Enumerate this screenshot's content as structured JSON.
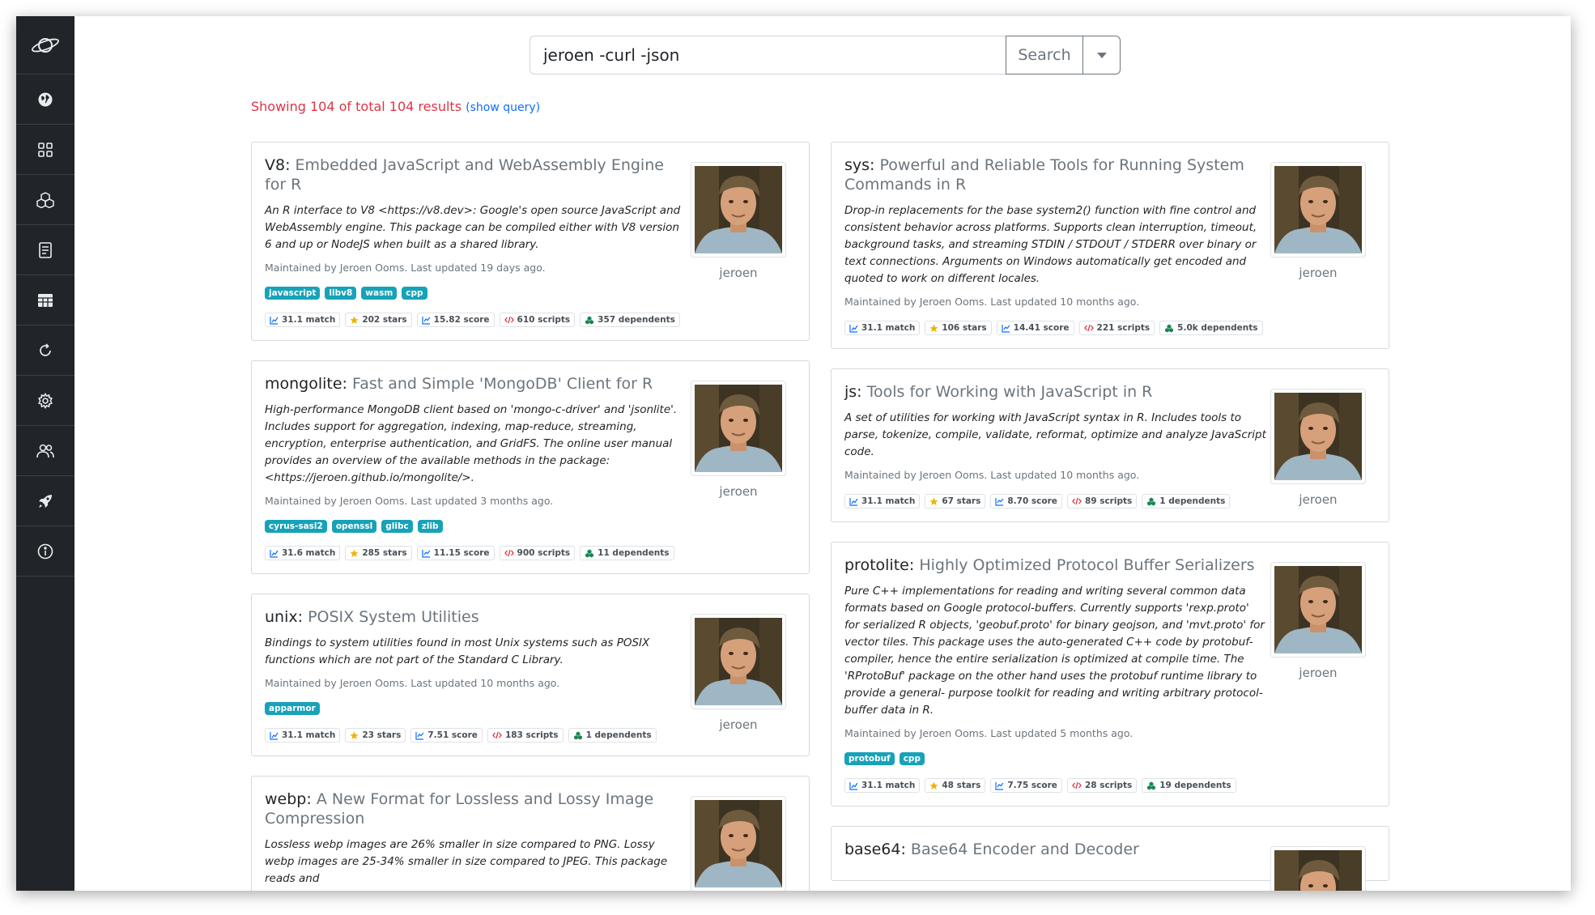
{
  "search": {
    "value": "jeroen -curl -json",
    "button_label": "Search"
  },
  "results": {
    "prefix": "Showing 104 of total 104 results",
    "show_query": "(show query)"
  },
  "sidebar": {
    "icons": [
      "planet-logo-icon",
      "globe-icon",
      "grid-icon",
      "packages-icon",
      "document-icon",
      "table-icon",
      "refresh-icon",
      "gear-icon",
      "users-icon",
      "rocket-icon",
      "info-icon"
    ]
  },
  "colors": {
    "sidebar": "#212529",
    "tag": "#17a2b8",
    "results_text": "#dc3545",
    "link": "#0d6efd"
  },
  "packages": [
    {
      "name": "V8:",
      "title": "Embedded JavaScript and WebAssembly Engine for R",
      "description": "An R interface to V8 <https://v8.dev>: Google's open source JavaScript and WebAssembly engine. This package can be compiled either with V8 version 6 and up or NodeJS when built as a shared library.",
      "maintainer": "Maintained by Jeroen Ooms. Last updated 19 days ago.",
      "tags": [
        "javascript",
        "libv8",
        "wasm",
        "cpp"
      ],
      "stats": [
        "31.1 match",
        "202 stars",
        "15.82 score",
        "610 scripts",
        "357 dependents"
      ],
      "user": "jeroen"
    },
    {
      "name": "mongolite:",
      "title": "Fast and Simple 'MongoDB' Client for R",
      "description": "High-performance MongoDB client based on 'mongo-c-driver' and 'jsonlite'. Includes support for aggregation, indexing, map-reduce, streaming, encryption, enterprise authentication, and GridFS. The online user manual provides an overview of the available methods in the package: <https://jeroen.github.io/mongolite/>.",
      "maintainer": "Maintained by Jeroen Ooms. Last updated 3 months ago.",
      "tags": [
        "cyrus-sasl2",
        "openssl",
        "glibc",
        "zlib"
      ],
      "stats": [
        "31.6 match",
        "285 stars",
        "11.15 score",
        "900 scripts",
        "11 dependents"
      ],
      "user": "jeroen"
    },
    {
      "name": "unix:",
      "title": "POSIX System Utilities",
      "description": "Bindings to system utilities found in most Unix systems such as POSIX functions which are not part of the Standard C Library.",
      "maintainer": "Maintained by Jeroen Ooms. Last updated 10 months ago.",
      "tags": [
        "apparmor"
      ],
      "stats": [
        "31.1 match",
        "23 stars",
        "7.51 score",
        "183 scripts",
        "1 dependents"
      ],
      "user": "jeroen"
    },
    {
      "name": "webp:",
      "title": "A New Format for Lossless and Lossy Image Compression",
      "description": "Lossless webp images are 26% smaller in size compared to PNG. Lossy webp images are 25-34% smaller in size compared to JPEG. This package reads and",
      "maintainer": "",
      "tags": [],
      "stats": [],
      "user": ""
    },
    {
      "name": "sys:",
      "title": "Powerful and Reliable Tools for Running System Commands in R",
      "description": "Drop-in replacements for the base system2() function with fine control and consistent behavior across platforms. Supports clean interruption, timeout, background tasks, and streaming STDIN / STDOUT / STDERR over binary or text connections. Arguments on Windows automatically get encoded and quoted to work on different locales.",
      "maintainer": "Maintained by Jeroen Ooms. Last updated 10 months ago.",
      "tags": [],
      "stats": [
        "31.1 match",
        "106 stars",
        "14.41 score",
        "221 scripts",
        "5.0k dependents"
      ],
      "user": "jeroen"
    },
    {
      "name": "js:",
      "title": "Tools for Working with JavaScript in R",
      "description": "A set of utilities for working with JavaScript syntax in R. Includes tools to parse, tokenize, compile, validate, reformat, optimize and analyze JavaScript code.",
      "maintainer": "Maintained by Jeroen Ooms. Last updated 10 months ago.",
      "tags": [],
      "stats": [
        "31.1 match",
        "67 stars",
        "8.70 score",
        "89 scripts",
        "1 dependents"
      ],
      "user": "jeroen"
    },
    {
      "name": "protolite:",
      "title": "Highly Optimized Protocol Buffer Serializers",
      "description": "Pure C++ implementations for reading and writing several common data formats based on Google protocol-buffers. Currently supports 'rexp.proto' for serialized R objects, 'geobuf.proto' for binary geojson, and 'mvt.proto' for vector tiles. This package uses the auto-generated C++ code by protobuf-compiler, hence the entire serialization is optimized at compile time. The 'RProtoBuf' package on the other hand uses the protobuf runtime library to provide a general- purpose toolkit for reading and writing arbitrary protocol-buffer data in R.",
      "maintainer": "Maintained by Jeroen Ooms. Last updated 5 months ago.",
      "tags": [
        "protobuf",
        "cpp"
      ],
      "stats": [
        "31.1 match",
        "48 stars",
        "7.75 score",
        "28 scripts",
        "19 dependents"
      ],
      "user": "jeroen"
    },
    {
      "name": "base64:",
      "title": "Base64 Encoder and Decoder",
      "description": "",
      "maintainer": "",
      "tags": [],
      "stats": [],
      "user": ""
    }
  ]
}
